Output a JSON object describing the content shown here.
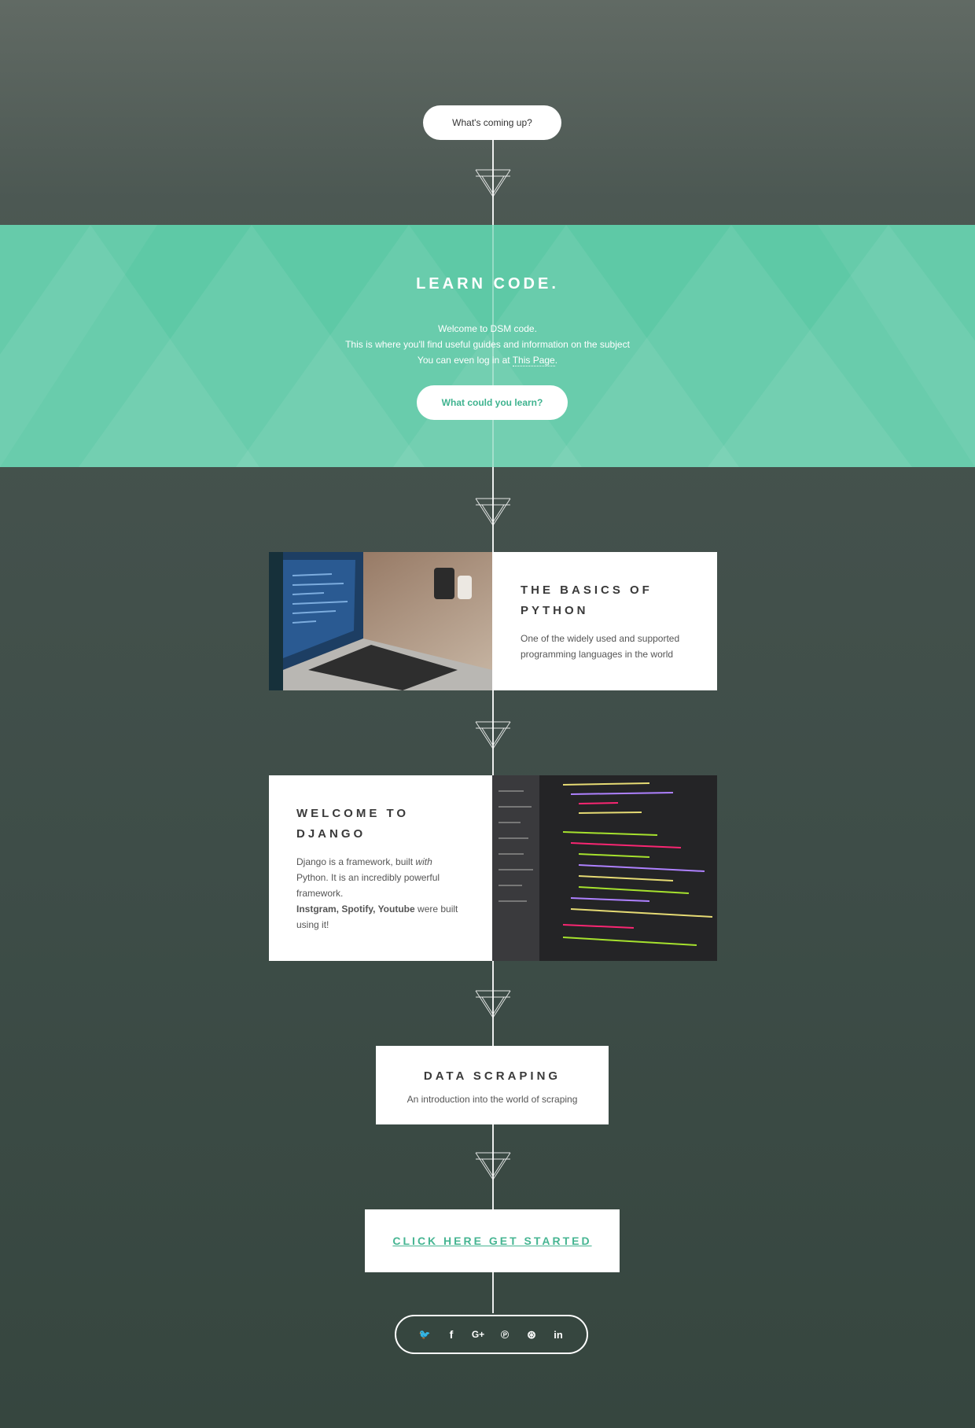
{
  "header": {
    "pill_label": "What's coming up?"
  },
  "hero": {
    "title": "LEARN CODE.",
    "line1": "Welcome to DSM code.",
    "line2": "This is where you'll find useful guides and information on the subject",
    "line3_prefix": "You can even log in at ",
    "line3_link": "This Page",
    "line3_suffix": ".",
    "button_label": "What could you learn?",
    "accent_color": "#5ec9a6"
  },
  "cards": {
    "python": {
      "title_line1": "THE BASICS OF",
      "title_line2": "PYTHON",
      "body_line1": "One of the widely used and supported",
      "body_line2": "programming languages in the world"
    },
    "django": {
      "title_line1": "WELCOME TO",
      "title_line2": "DJANGO",
      "body_part1": "Django is a framework, built ",
      "body_em": "with",
      "body_part2": "Python. It is an incredibly powerful framework.",
      "body_bold": "Instgram, Spotify, Youtube",
      "body_part3": " were built using it!"
    },
    "scraping": {
      "title": "DATA SCRAPING",
      "body": "An introduction into the world of scraping"
    }
  },
  "cta": {
    "label": "CLICK HERE GET STARTED"
  },
  "social": {
    "twitter": "🐦",
    "facebook": "f",
    "google_plus": "G+",
    "pinterest": "℗",
    "dribbble": "⊛",
    "linkedin": "in"
  }
}
